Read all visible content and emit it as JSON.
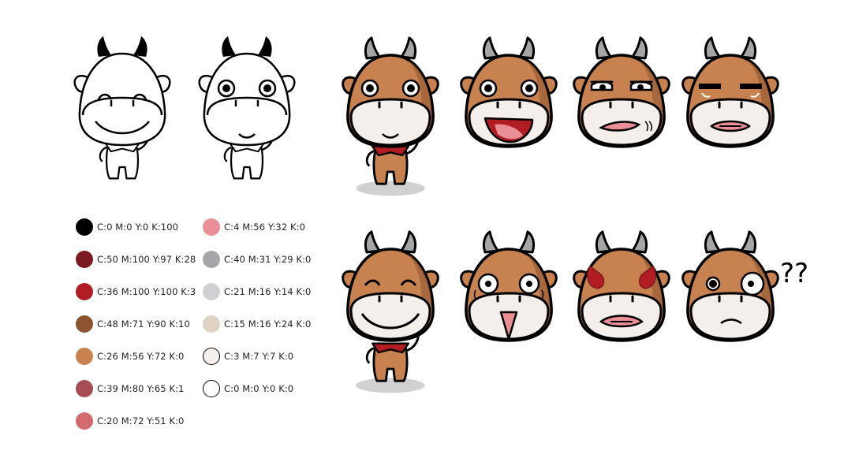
{
  "palette": {
    "left_column": [
      {
        "label": "C:0  M:0  Y:0  K:100",
        "color": "#000000"
      },
      {
        "label": "C:50  M:100  Y:97  K:28",
        "color": "#7b1a1f"
      },
      {
        "label": "C:36  M:100  Y:100  K:3",
        "color": "#b21d24"
      },
      {
        "label": "C:48  M:71  Y:90  K:10",
        "color": "#8d5430"
      },
      {
        "label": "C:26  M:56  Y:72  K:0",
        "color": "#c8824f"
      },
      {
        "label": "C:39  M:80  Y:65  K:1",
        "color": "#a64c52"
      },
      {
        "label": "C:20  M:72  Y:51  K:0",
        "color": "#d46a6f"
      }
    ],
    "right_column": [
      {
        "label": "C:4  M:56  Y:32  K:0",
        "color": "#ea8f95"
      },
      {
        "label": "C:40  M:31  Y:29  K:0",
        "color": "#a4a6a8"
      },
      {
        "label": "C:21  M:16  Y:14  K:0",
        "color": "#d1d1d3"
      },
      {
        "label": "C:15  M:16  Y:24  K:0",
        "color": "#dfd4c3"
      },
      {
        "label": "C:3  M:7  Y:7  K:0",
        "color": "#f5efec"
      },
      {
        "label": "C:0  M:0  Y:0  K:0",
        "color": "#ffffff"
      }
    ]
  },
  "annotations": {
    "question_marks": "??"
  },
  "mascot": {
    "fur": "#c8824f",
    "fur_dark": "#8d5430",
    "muzzle": "#f5efec",
    "horn": "#a4a6a8",
    "tongue": "#ea8f95",
    "scarf": "#b21d24",
    "anger": "#b21d24",
    "outline": "#000000"
  },
  "figures": [
    {
      "id": "sketch-happy"
    },
    {
      "id": "sketch-smile"
    },
    {
      "id": "full-body-smile"
    },
    {
      "id": "face-tongue"
    },
    {
      "id": "face-annoyed"
    },
    {
      "id": "face-stern"
    },
    {
      "id": "full-body-laugh"
    },
    {
      "id": "face-shocked"
    },
    {
      "id": "face-angry"
    },
    {
      "id": "face-confused"
    }
  ]
}
